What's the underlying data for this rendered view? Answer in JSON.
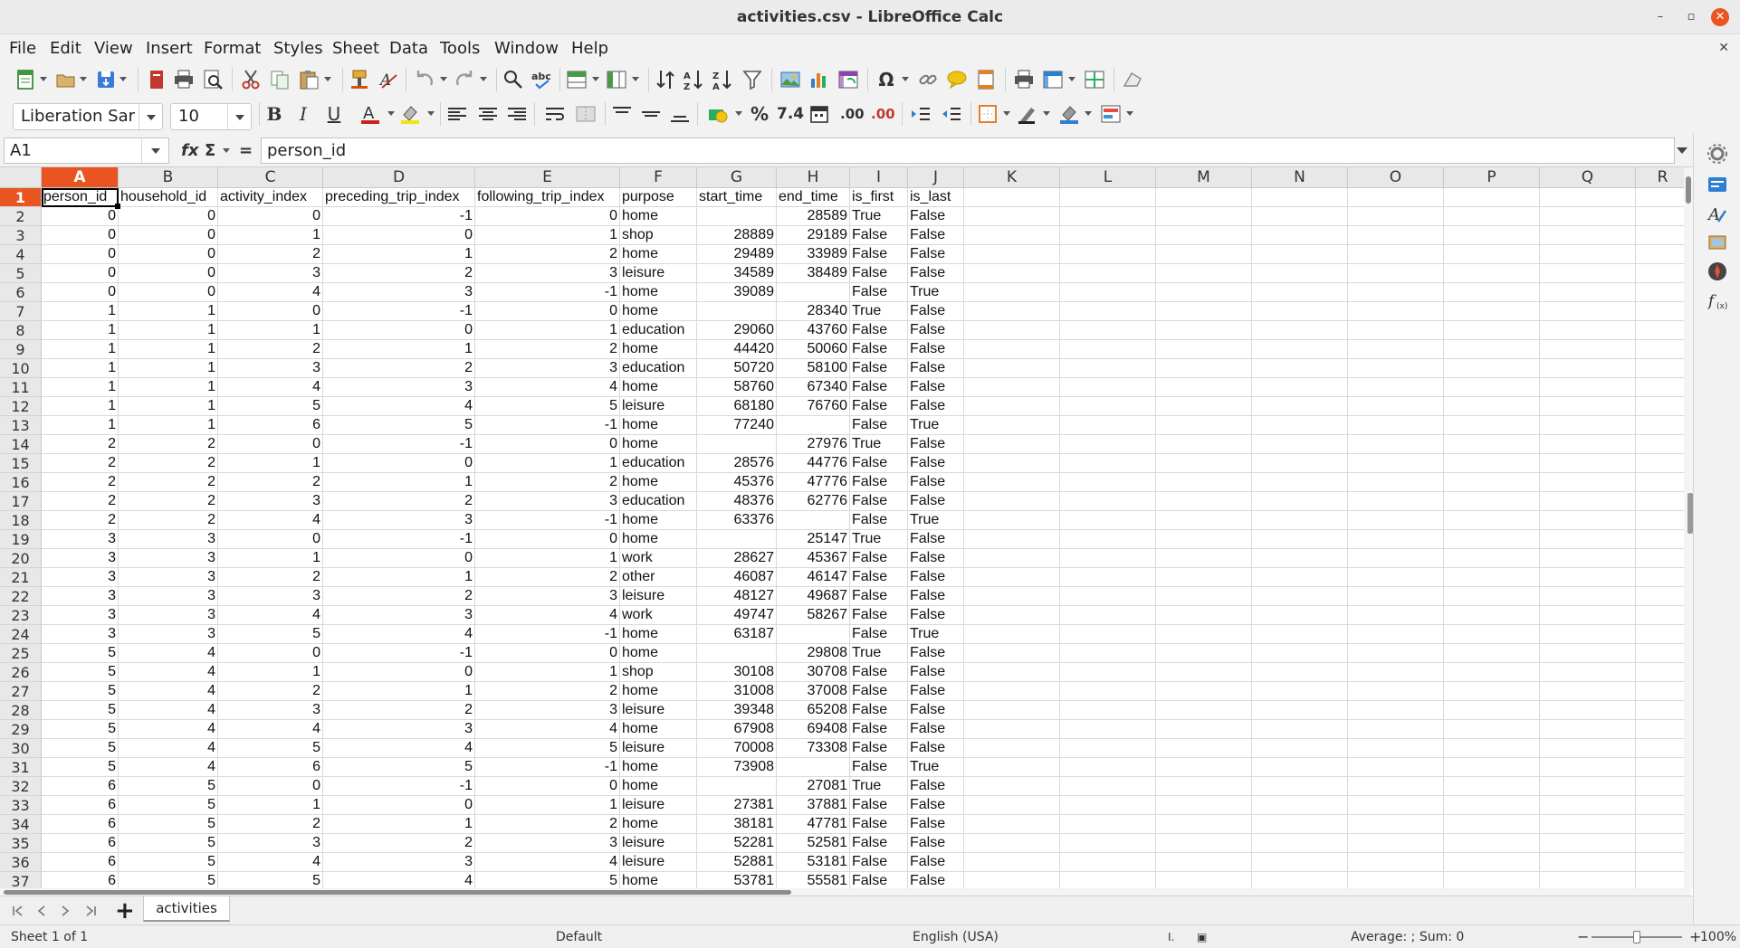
{
  "window": {
    "title": "activities.csv - LibreOffice Calc",
    "minimize": "–",
    "maximize": "▫",
    "close": "✕"
  },
  "menu": [
    "File",
    "Edit",
    "View",
    "Insert",
    "Format",
    "Styles",
    "Sheet",
    "Data",
    "Tools",
    "Window",
    "Help"
  ],
  "doc_close": "✕",
  "formatting": {
    "font_name": "Liberation Sar",
    "font_size": "10",
    "bold": "B",
    "italic": "I",
    "underline": "U",
    "percent": "%",
    "number": "7.4",
    "add_decimal": ".00",
    "del_decimal": ".00"
  },
  "formula_bar": {
    "cell_ref": "A1",
    "fx": "fx",
    "sum": "Σ",
    "equals": "=",
    "content": "person_id"
  },
  "grid": {
    "active_column": "A",
    "active_row": "1",
    "columns": [
      "A",
      "B",
      "C",
      "D",
      "E",
      "F",
      "G",
      "H",
      "I",
      "J",
      "K",
      "L",
      "M",
      "N",
      "O",
      "P",
      "Q",
      "R"
    ],
    "rows": [
      [
        "person_id",
        "household_id",
        "activity_index",
        "preceding_trip_index",
        "following_trip_index",
        "purpose",
        "start_time",
        "end_time",
        "is_first",
        "is_last"
      ],
      [
        "0",
        "0",
        "0",
        "-1",
        "0",
        "home",
        "",
        "28589",
        "True",
        "False"
      ],
      [
        "0",
        "0",
        "1",
        "0",
        "1",
        "shop",
        "28889",
        "29189",
        "False",
        "False"
      ],
      [
        "0",
        "0",
        "2",
        "1",
        "2",
        "home",
        "29489",
        "33989",
        "False",
        "False"
      ],
      [
        "0",
        "0",
        "3",
        "2",
        "3",
        "leisure",
        "34589",
        "38489",
        "False",
        "False"
      ],
      [
        "0",
        "0",
        "4",
        "3",
        "-1",
        "home",
        "39089",
        "",
        "False",
        "True"
      ],
      [
        "1",
        "1",
        "0",
        "-1",
        "0",
        "home",
        "",
        "28340",
        "True",
        "False"
      ],
      [
        "1",
        "1",
        "1",
        "0",
        "1",
        "education",
        "29060",
        "43760",
        "False",
        "False"
      ],
      [
        "1",
        "1",
        "2",
        "1",
        "2",
        "home",
        "44420",
        "50060",
        "False",
        "False"
      ],
      [
        "1",
        "1",
        "3",
        "2",
        "3",
        "education",
        "50720",
        "58100",
        "False",
        "False"
      ],
      [
        "1",
        "1",
        "4",
        "3",
        "4",
        "home",
        "58760",
        "67340",
        "False",
        "False"
      ],
      [
        "1",
        "1",
        "5",
        "4",
        "5",
        "leisure",
        "68180",
        "76760",
        "False",
        "False"
      ],
      [
        "1",
        "1",
        "6",
        "5",
        "-1",
        "home",
        "77240",
        "",
        "False",
        "True"
      ],
      [
        "2",
        "2",
        "0",
        "-1",
        "0",
        "home",
        "",
        "27976",
        "True",
        "False"
      ],
      [
        "2",
        "2",
        "1",
        "0",
        "1",
        "education",
        "28576",
        "44776",
        "False",
        "False"
      ],
      [
        "2",
        "2",
        "2",
        "1",
        "2",
        "home",
        "45376",
        "47776",
        "False",
        "False"
      ],
      [
        "2",
        "2",
        "3",
        "2",
        "3",
        "education",
        "48376",
        "62776",
        "False",
        "False"
      ],
      [
        "2",
        "2",
        "4",
        "3",
        "-1",
        "home",
        "63376",
        "",
        "False",
        "True"
      ],
      [
        "3",
        "3",
        "0",
        "-1",
        "0",
        "home",
        "",
        "25147",
        "True",
        "False"
      ],
      [
        "3",
        "3",
        "1",
        "0",
        "1",
        "work",
        "28627",
        "45367",
        "False",
        "False"
      ],
      [
        "3",
        "3",
        "2",
        "1",
        "2",
        "other",
        "46087",
        "46147",
        "False",
        "False"
      ],
      [
        "3",
        "3",
        "3",
        "2",
        "3",
        "leisure",
        "48127",
        "49687",
        "False",
        "False"
      ],
      [
        "3",
        "3",
        "4",
        "3",
        "4",
        "work",
        "49747",
        "58267",
        "False",
        "False"
      ],
      [
        "3",
        "3",
        "5",
        "4",
        "-1",
        "home",
        "63187",
        "",
        "False",
        "True"
      ],
      [
        "5",
        "4",
        "0",
        "-1",
        "0",
        "home",
        "",
        "29808",
        "True",
        "False"
      ],
      [
        "5",
        "4",
        "1",
        "0",
        "1",
        "shop",
        "30108",
        "30708",
        "False",
        "False"
      ],
      [
        "5",
        "4",
        "2",
        "1",
        "2",
        "home",
        "31008",
        "37008",
        "False",
        "False"
      ],
      [
        "5",
        "4",
        "3",
        "2",
        "3",
        "leisure",
        "39348",
        "65208",
        "False",
        "False"
      ],
      [
        "5",
        "4",
        "4",
        "3",
        "4",
        "home",
        "67908",
        "69408",
        "False",
        "False"
      ],
      [
        "5",
        "4",
        "5",
        "4",
        "5",
        "leisure",
        "70008",
        "73308",
        "False",
        "False"
      ],
      [
        "5",
        "4",
        "6",
        "5",
        "-1",
        "home",
        "73908",
        "",
        "False",
        "True"
      ],
      [
        "6",
        "5",
        "0",
        "-1",
        "0",
        "home",
        "",
        "27081",
        "True",
        "False"
      ],
      [
        "6",
        "5",
        "1",
        "0",
        "1",
        "leisure",
        "27381",
        "37881",
        "False",
        "False"
      ],
      [
        "6",
        "5",
        "2",
        "1",
        "2",
        "home",
        "38181",
        "47781",
        "False",
        "False"
      ],
      [
        "6",
        "5",
        "3",
        "2",
        "3",
        "leisure",
        "52281",
        "52581",
        "False",
        "False"
      ],
      [
        "6",
        "5",
        "4",
        "3",
        "4",
        "leisure",
        "52881",
        "53181",
        "False",
        "False"
      ],
      [
        "6",
        "5",
        "5",
        "4",
        "5",
        "home",
        "53781",
        "55581",
        "False",
        "False"
      ]
    ]
  },
  "sheet_tabs": {
    "add": "+",
    "tabs": [
      "activities"
    ]
  },
  "status": {
    "sheet": "Sheet 1 of 1",
    "page_style": "Default",
    "language": "English (USA)",
    "summary": "Average: ; Sum: 0",
    "zoom_minus": "−",
    "zoom_plus": "+",
    "zoom": "100%",
    "zoom_level_fraction": 0.5
  },
  "colors": {
    "accent": "#e95420",
    "header_bg": "#e8e8e8",
    "toolbar_bg": "#f2f2f2"
  },
  "icons": [
    "new-icon",
    "open-icon",
    "save-icon",
    "export-pdf-icon",
    "print-icon",
    "print-preview-icon",
    "cut-icon",
    "copy-icon",
    "paste-icon",
    "clone-formatting-icon",
    "clear-formatting-icon",
    "undo-icon",
    "redo-icon",
    "find-replace-icon",
    "spelling-icon",
    "row-icon",
    "column-icon",
    "sort-icon",
    "sort-ascending-icon",
    "sort-descending-icon",
    "autofilter-icon",
    "image-icon",
    "chart-icon",
    "pivot-table-icon",
    "special-character-icon",
    "hyperlink-icon",
    "comment-icon",
    "header-footer-icon",
    "define-print-area-icon",
    "freeze-rows-icon",
    "split-window-icon",
    "draw-functions-icon"
  ]
}
